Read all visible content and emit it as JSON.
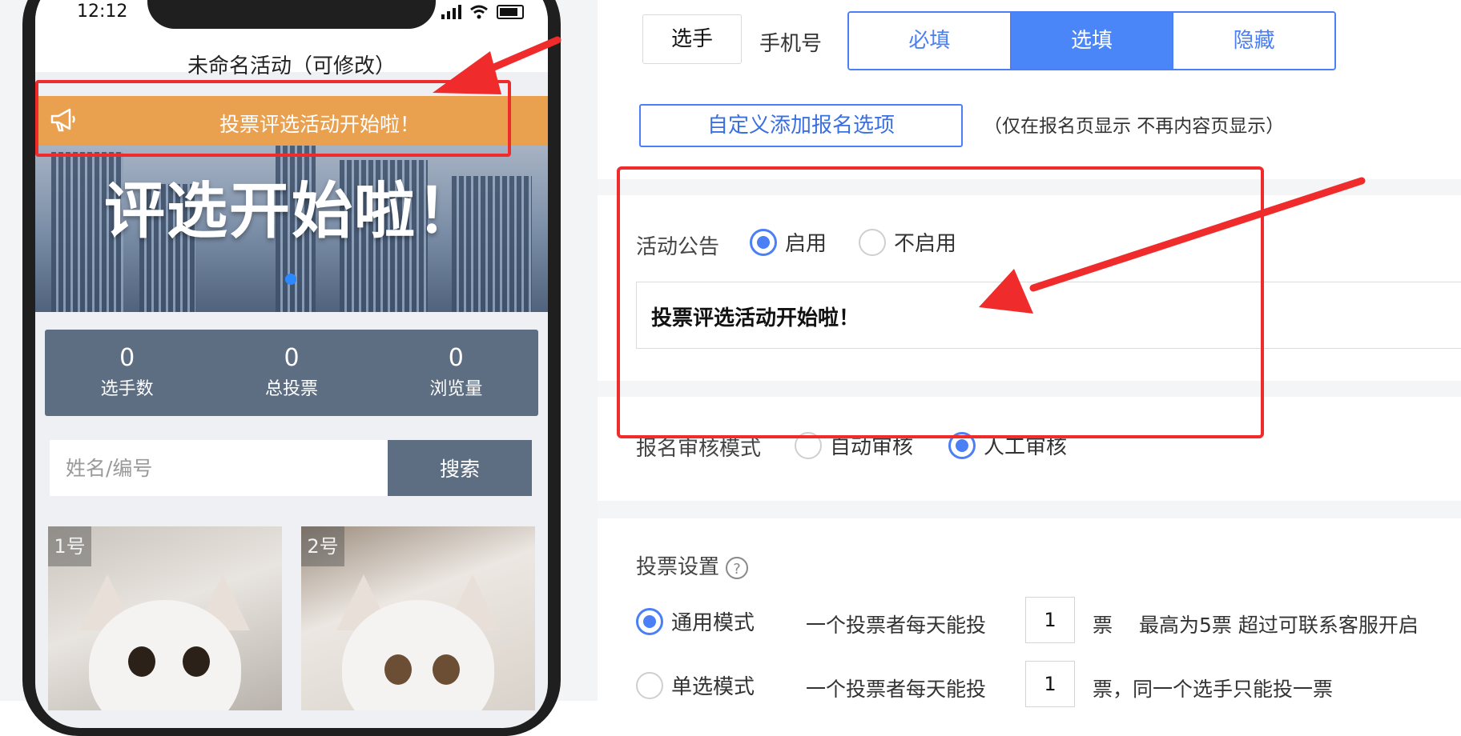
{
  "phone": {
    "status_time": "12:12",
    "app_title": "未命名活动（可修改）",
    "announcement_text": "投票评选活动开始啦！",
    "banner_headline": "评选开始啦！",
    "stats": [
      {
        "value": "0",
        "label": "选手数"
      },
      {
        "value": "0",
        "label": "总投票"
      },
      {
        "value": "0",
        "label": "浏览量"
      }
    ],
    "search_placeholder": "姓名/编号",
    "search_button": "搜索",
    "contestants": [
      {
        "label": "1号"
      },
      {
        "label": "2号"
      }
    ]
  },
  "settings": {
    "player_tag": "选手",
    "phone_field_label": "手机号",
    "phone_options": [
      "必填",
      "选填",
      "隐藏"
    ],
    "phone_selected": "选填",
    "custom_add_button": "自定义添加报名选项",
    "custom_add_note": "（仅在报名页显示 不再内容页显示）",
    "announcement": {
      "label": "活动公告",
      "options": [
        "启用",
        "不启用"
      ],
      "selected": "启用",
      "text": "投票评选活动开始啦！"
    },
    "review": {
      "label": "报名审核模式",
      "options": [
        "自动审核",
        "人工审核"
      ],
      "selected": "人工审核"
    },
    "vote": {
      "label": "投票设置",
      "modes": [
        {
          "name": "通用模式",
          "prefix": "一个投票者每天能投",
          "count": "1",
          "suffix": "票",
          "note": "最高为5票 超过可联系客服开启"
        },
        {
          "name": "单选模式",
          "prefix": "一个投票者每天能投",
          "count": "1",
          "suffix": "票，同一个选手只能投一票",
          "note": ""
        }
      ],
      "selected": "通用模式"
    }
  },
  "colors": {
    "accent": "#4a7ff5",
    "announce_bar": "#e9a04f",
    "stats_bg": "#5e6e82",
    "highlight_red": "#ef2b2b"
  }
}
